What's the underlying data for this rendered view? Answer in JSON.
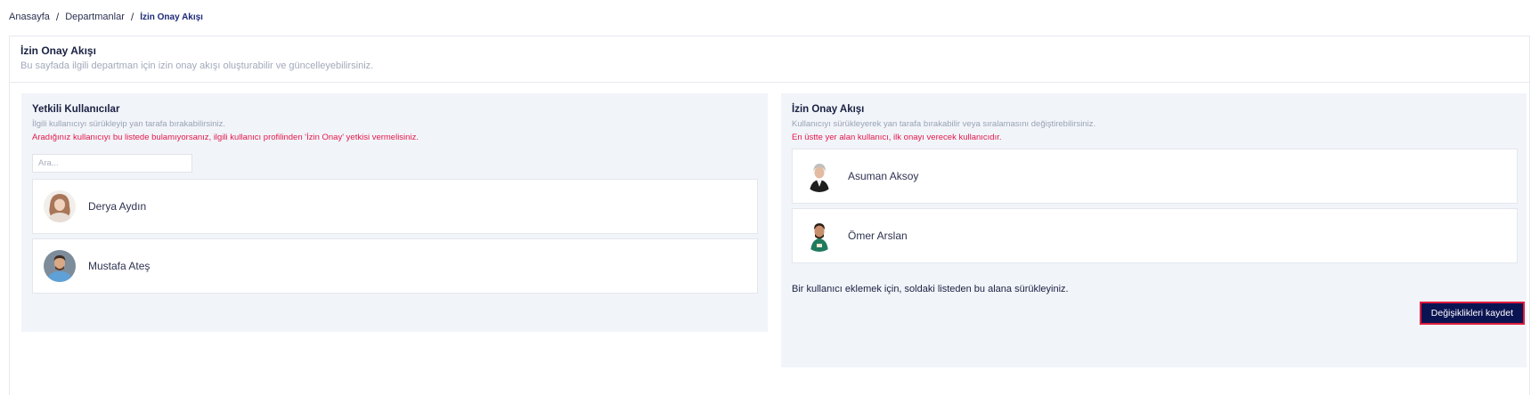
{
  "breadcrumb": {
    "home": "Anasayfa",
    "departments": "Departmanlar",
    "current": "İzin Onay Akışı",
    "separator": "/"
  },
  "header": {
    "title": "İzin Onay Akışı",
    "subtitle": "Bu sayfada ilgili departman için izin onay akışı oluşturabilir ve güncelleyebilirsiniz."
  },
  "authorized": {
    "title": "Yetkili Kullanıcılar",
    "hint": "İlgili kullanıcıyı sürükleyip yan tarafa bırakabilirsiniz.",
    "warning": "Aradığınız kullanıcıyı bu listede bulamıyorsanız, ilgili kullanıcı profilinden 'İzin Onay' yetkisi vermelisiniz.",
    "search_placeholder": "Ara...",
    "users": [
      {
        "name": "Derya Aydın"
      },
      {
        "name": "Mustafa Ateş"
      }
    ]
  },
  "flow": {
    "title": "İzin Onay Akışı",
    "hint": "Kullanıcıyı sürükleyerek yan tarafa bırakabilir veya sıralamasını değiştirebilirsiniz.",
    "warning": "En üstte yer alan kullanıcı, ilk onayı verecek kullanıcıdır.",
    "users": [
      {
        "name": "Asuman Aksoy"
      },
      {
        "name": "Ömer Arslan"
      }
    ],
    "drop_hint": "Bir kullanıcı eklemek için, soldaki listeden bu alana sürükleyiniz.",
    "save_label": "Değişiklikleri kaydet"
  },
  "colors": {
    "accent": "#0b1452",
    "warning": "#e5184a",
    "panel_bg": "#f1f4f9"
  }
}
